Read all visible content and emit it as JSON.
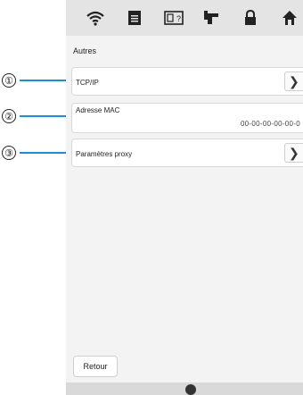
{
  "section_title": "Autres",
  "top_tabs": [
    {
      "icon": "wifi-icon"
    },
    {
      "icon": "document-icon"
    },
    {
      "icon": "help-icon"
    },
    {
      "icon": "embroidery-icon"
    },
    {
      "icon": "lock-icon"
    },
    {
      "icon": "home-icon"
    }
  ],
  "items": [
    {
      "label": "TCP/IP",
      "chevron": "❯"
    },
    {
      "label": "Adresse MAC",
      "value": "00-00-00-00-00-0"
    },
    {
      "label": "Paramètres proxy",
      "chevron": "❯"
    }
  ],
  "callouts": [
    "①",
    "②",
    "③"
  ],
  "back_label": "Retour",
  "colors": {
    "callout_line": "#1a8fd6"
  }
}
